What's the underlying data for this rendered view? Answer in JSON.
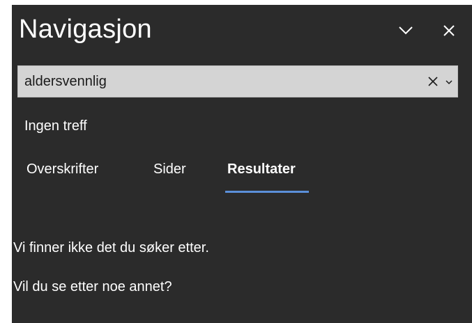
{
  "pane": {
    "title": "Navigasjon",
    "controls": {
      "dropdown_icon": "chevron-down-icon",
      "close_icon": "close-icon"
    }
  },
  "search": {
    "value": "aldersvennlig",
    "clear_icon": "close-icon",
    "options_icon": "chevron-down-icon"
  },
  "status": {
    "text": "Ingen treff"
  },
  "tabs": [
    {
      "label": "Overskrifter",
      "selected": false
    },
    {
      "label": "Sider",
      "selected": false
    },
    {
      "label": "Resultater",
      "selected": true
    }
  ],
  "results": {
    "message_line_1": "Vi finner ikke det du søker etter.",
    "message_line_2": "Vil du se etter noe annet?"
  },
  "colors": {
    "pane_background": "#2b2b2b",
    "search_background": "#d4d4d4",
    "accent": "#5b8fd9",
    "text": "#ffffff"
  }
}
